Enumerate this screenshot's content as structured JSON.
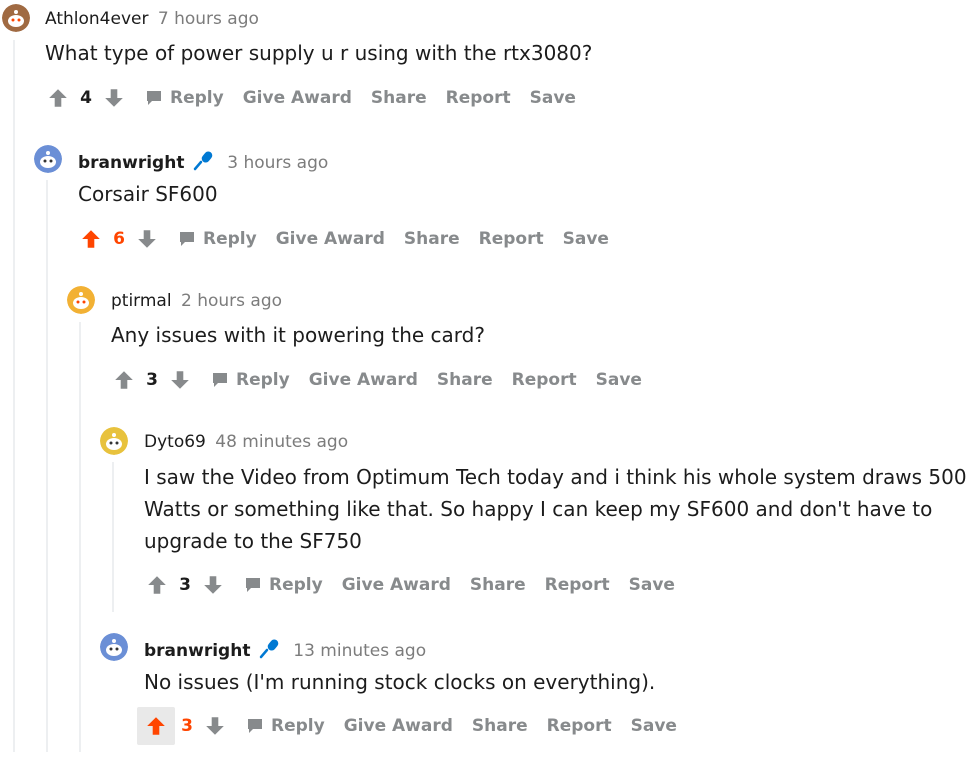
{
  "comments": [
    {
      "author": "Athlon4ever",
      "time": "7 hours ago",
      "body": [
        "What type of power supply u r using with the rtx3080?"
      ],
      "score": "4",
      "upvoted": false,
      "op": false
    },
    {
      "author": "branwright",
      "time": "3 hours ago",
      "body": [
        "Corsair SF600"
      ],
      "score": "6",
      "upvoted": true,
      "op": true
    },
    {
      "author": "ptirmal",
      "time": "2 hours ago",
      "body": [
        "Any issues with it powering the card?"
      ],
      "score": "3",
      "upvoted": false,
      "op": false
    },
    {
      "author": "Dyto69",
      "time": "48 minutes ago",
      "body": [
        "I saw the Video from Optimum Tech today and i think his whole system draws 500",
        "Watts or something like that. So happy I can keep my SF600 and don't have to",
        "upgrade to the SF750"
      ],
      "score": "3",
      "upvoted": false,
      "op": false
    },
    {
      "author": "branwright",
      "time": "13 minutes ago",
      "body": [
        "No issues (I'm running stock clocks on everything)."
      ],
      "score": "3",
      "upvoted": true,
      "op": true
    }
  ],
  "actions": {
    "reply": "Reply",
    "give_award": "Give Award",
    "share": "Share",
    "report": "Report",
    "save": "Save"
  },
  "colors": {
    "upvote_active": "#ff4500",
    "muted": "#878a8c",
    "mic": "#0079d3"
  },
  "icons": [
    "upvote-arrow-icon",
    "downvote-arrow-icon",
    "reply-bubble-icon",
    "microphone-icon",
    "snoo-avatar-icon"
  ]
}
